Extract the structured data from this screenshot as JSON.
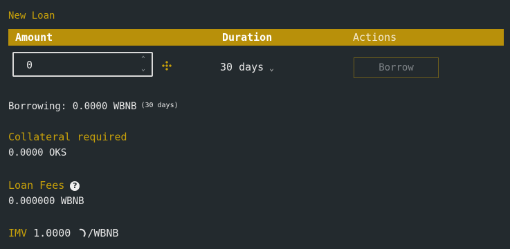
{
  "title": "New Loan",
  "columns": {
    "amount": "Amount",
    "duration": "Duration",
    "actions": "Actions"
  },
  "amount_input": {
    "value": "0"
  },
  "duration_select": {
    "selected": "30 days"
  },
  "borrow_button": "Borrow",
  "borrowing": {
    "text": "Borrowing: 0.0000 WBNB",
    "days": "(30 days)"
  },
  "collateral": {
    "label": "Collateral required",
    "value": "0.0000 OKS"
  },
  "loan_fees": {
    "label": "Loan Fees",
    "value": "0.000000 WBNB"
  },
  "imv": {
    "label": "IMV",
    "value": "1.0000",
    "unit": "/WBNB"
  },
  "colors": {
    "background": "#232a2e",
    "accent": "#c8a10a",
    "header_bar": "#b8900a"
  },
  "icons": {
    "token": "bnb-icon",
    "help": "help-icon",
    "imv_token": "token-icon"
  }
}
